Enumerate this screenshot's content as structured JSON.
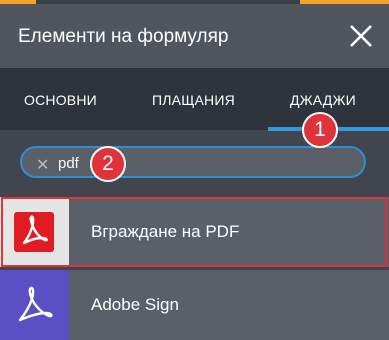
{
  "panel": {
    "title": "Елементи на формуляр",
    "close_icon": "close-icon"
  },
  "tabs": [
    {
      "label": "ОСНОВНИ",
      "active": false
    },
    {
      "label": "ПЛАЩАНИЯ",
      "active": false
    },
    {
      "label": "ДЖАДЖИ",
      "active": true
    }
  ],
  "search": {
    "value": "pdf",
    "clear_icon": "clear-icon"
  },
  "results": [
    {
      "label": "Вграждане на PDF",
      "icon": "acrobat-pdf-icon",
      "icon_bg": "#e5e5e5",
      "highlighted": true
    },
    {
      "label": "Adobe Sign",
      "icon": "adobe-sign-icon",
      "icon_bg": "#5a4fc4",
      "highlighted": false
    }
  ],
  "annotations": [
    {
      "number": "1"
    },
    {
      "number": "2"
    }
  ],
  "colors": {
    "accent_blue": "#2e9ae4",
    "highlight_red": "#e0323a",
    "header_bg": "#50555e",
    "tabs_bg": "#2f333b"
  }
}
